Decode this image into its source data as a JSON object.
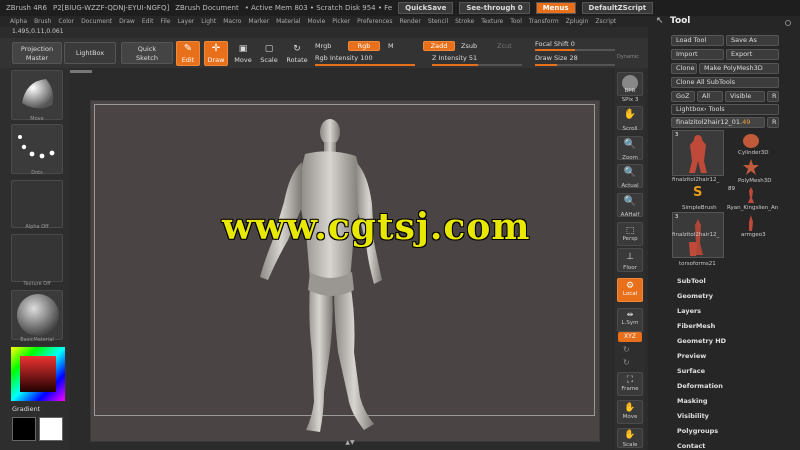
{
  "titlebar": {
    "app": "ZBrush 4R6",
    "id": "P2[BIUG-WZZF-QDNJ-EYUI-NGFQ]",
    "doc": "ZBrush Document",
    "mem": "• Active Mem 803 • Scratch Disk 954 • Fe",
    "quicksave": "QuickSave",
    "seethrough": "See-through  0",
    "menus": "Menus",
    "script": "DefaultZScript"
  },
  "menubar": [
    "Alpha",
    "Brush",
    "Color",
    "Document",
    "Draw",
    "Edit",
    "File",
    "Layer",
    "Light",
    "Macro",
    "Marker",
    "Material",
    "Movie",
    "Picker",
    "Preferences",
    "Render",
    "Stencil",
    "Stroke",
    "Texture",
    "Tool",
    "Transform",
    "Zplugin",
    "Zscript"
  ],
  "coords": "1.495,0.11,0.061",
  "topshelf": {
    "projection_master": "Projection\nMaster",
    "lightbox": "LightBox",
    "quick_sketch": "Quick\nSketch",
    "edit": "Edit",
    "draw": "Draw",
    "move": "Move",
    "scale": "Scale",
    "rotate": "Rotate",
    "mrgb": "Mrgb",
    "rgb": "Rgb",
    "m": "M",
    "zadd": "Zadd",
    "zsub": "Zsub",
    "zcut": "Zcut",
    "focal_shift": "Focal Shift",
    "focal_shift_value": "0",
    "rgb_intensity": "Rgb Intensity",
    "rgb_intensity_value": "100",
    "z_intensity": "Z Intensity",
    "z_intensity_value": "51",
    "draw_size": "Draw Size",
    "draw_size_value": "28",
    "dynamic": "Dynamic"
  },
  "leftshelf": {
    "move": "Move",
    "dots": "Dots",
    "alpha_off": "Alpha Off",
    "texture_off": "Texture Off",
    "material": "BasicMaterial",
    "gradient": "Gradient"
  },
  "watermark": "www.cgtsj.com",
  "rightshelf": {
    "bpr": "BPR",
    "spix": "SPix  3",
    "scroll": "Scroll",
    "zoom": "Zoom",
    "actual": "Actual",
    "aahalf": "AAHalf",
    "persp": "Persp",
    "floor": "Floor",
    "local": "Local",
    "lsym": "L.Sym",
    "xyz": "XYZ",
    "frame": "Frame",
    "move": "Move",
    "scale": "Scale"
  },
  "toolpanel": {
    "title": "Tool",
    "load_tool": "Load Tool",
    "save_as": "Save As",
    "import": "Import",
    "export": "Export",
    "clone": "Clone",
    "make_polymesh": "Make PolyMesh3D",
    "clone_all": "Clone All SubTools",
    "goz": "GoZ",
    "all": "All",
    "visible": "Visible",
    "r": "R",
    "lightbox_tools": "Lightbox› Tools",
    "current_tool": "finalzitol2hair12_01.",
    "current_value": "49",
    "tools": [
      {
        "name": "finalzitol2hair12_",
        "count": "3"
      },
      {
        "name": "Cylinder3D",
        "count": ""
      },
      {
        "name": "PolyMesh3D",
        "count": ""
      },
      {
        "name": "SimpleBrush",
        "count": ""
      },
      {
        "name": "Ryan_Kingslien_An",
        "count": "89"
      },
      {
        "name": "finalzitol2hair12_",
        "count": "3"
      },
      {
        "name": "armgeo3",
        "count": ""
      },
      {
        "name": "torsoforms21",
        "count": ""
      }
    ],
    "sections": [
      "SubTool",
      "Geometry",
      "Layers",
      "FiberMesh",
      "Geometry HD",
      "Preview",
      "Surface",
      "Deformation",
      "Masking",
      "Visibility",
      "Polygroups",
      "Contact"
    ]
  },
  "colors": {
    "accent": "#e8701a",
    "watermark": "#e8e800"
  }
}
